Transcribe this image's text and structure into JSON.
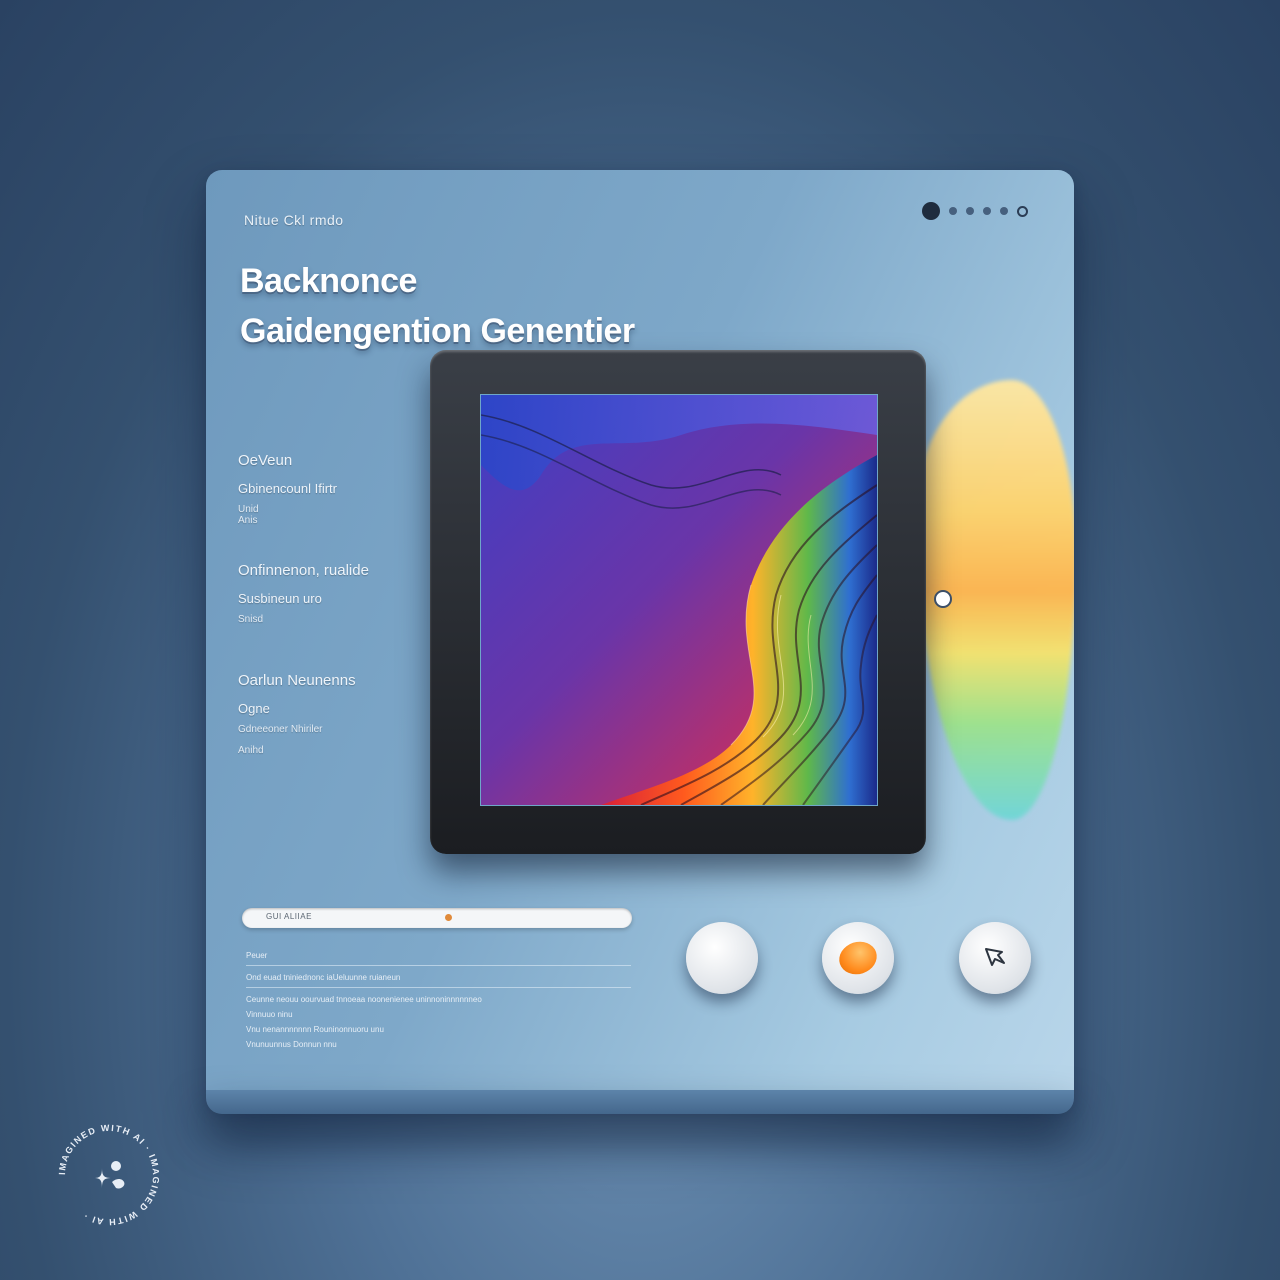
{
  "app": {
    "name": "Nitue Ckl rmdo"
  },
  "header": {
    "title_line1": "Backnonce",
    "title_line2": "Gaidengention Genentier"
  },
  "sidebar": {
    "sections": [
      {
        "heading": "OeVeun",
        "item": "Gbinencounl Ifirtr",
        "sub1": "Unid",
        "sub2": "Anis"
      },
      {
        "heading": "Onfinnenon, rualide",
        "item": "Susbineun uro",
        "sub1": "Snisd",
        "sub2": ""
      },
      {
        "heading": "Oarlun Neunenns",
        "item": "Ogne",
        "sub1": "Gdneeoner Nhiriler",
        "sub2": "Anihd"
      }
    ]
  },
  "controls": {
    "slider_label": "GUI ALIIAE",
    "slider_value": 0.53,
    "description_title": "Peuer",
    "description_lines": [
      "Ond euad  tniniednonc iaUeluunne ruianeun",
      "Ceunne  neouu  oourvuad tnnoeaa noonenienee uninnoninnnnnneo",
      "Vinnuuo                                    ninu",
      "Vnu nenannnnnnn Rouninonnuoru unu",
      "Vnunuunnus  Donnun nnu"
    ]
  },
  "buttons": {
    "b1_icon": "blank-circle",
    "b2_icon": "orange-dot-icon",
    "b3_icon": "cursor-arrow-icon"
  },
  "watermark": {
    "text": "IMAGINED WITH AI · IMAGINED WITH AI ·"
  },
  "colors": {
    "card": "#7ea8c9",
    "frame": "#1b1d21",
    "accent": "#ff8a1c"
  }
}
